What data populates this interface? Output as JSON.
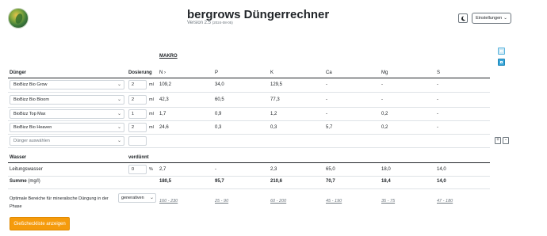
{
  "header": {
    "title": "bergrows Düngerrechner",
    "version": "Version 2.5",
    "version_date": "(2024-08-05)",
    "settings_label": "Einstellungen"
  },
  "section_title": "MAKRO",
  "table": {
    "headers": [
      "Dünger",
      "Dosierung",
      "N",
      "P",
      "K",
      "Ca",
      "Mg",
      "S"
    ],
    "rows": [
      {
        "name": "BioBizz Bio Grow",
        "qty": "2",
        "unit": "ml",
        "N": "109,2",
        "P": "34,0",
        "K": "129,5",
        "Ca": "-",
        "Mg": "-",
        "S": "-"
      },
      {
        "name": "BioBizz Bio Bloom",
        "qty": "2",
        "unit": "ml",
        "N": "42,3",
        "P": "60,5",
        "K": "77,3",
        "Ca": "-",
        "Mg": "-",
        "S": "-"
      },
      {
        "name": "BioBizz Top Max",
        "qty": "1",
        "unit": "ml",
        "N": "1,7",
        "P": "0,9",
        "K": "1,2",
        "Ca": "-",
        "Mg": "0,2",
        "S": "-"
      },
      {
        "name": "BioBizz Bio Heaven",
        "qty": "2",
        "unit": "ml",
        "N": "24,6",
        "P": "0,3",
        "K": "0,3",
        "Ca": "5,7",
        "Mg": "0,2",
        "S": "-"
      }
    ],
    "add_placeholder": "Dünger auswählen"
  },
  "water": {
    "header_wasser": "Wasser",
    "header_verduennt": "verdünnt",
    "label": "Leitungswasser",
    "qty": "0",
    "unit": "%",
    "N": "2,7",
    "P": "-",
    "K": "2,3",
    "Ca": "65,0",
    "Mg": "18,0",
    "S": "14,0"
  },
  "summe": {
    "label": "Summe",
    "unit": "(mg/l)",
    "N": "180,5",
    "P": "95,7",
    "K": "210,6",
    "Ca": "70,7",
    "Mg": "18,4",
    "S": "14,0"
  },
  "optimal": {
    "text_before": "Optimale Bereiche für mineralische Düngung in der",
    "phase_select": "generativen",
    "text_after": "Phase",
    "N": "160 - 230",
    "P": "25 - 90",
    "K": "60 - 200",
    "Ca": "45 - 190",
    "Mg": "35 - 75",
    "S": "47 - 180"
  },
  "buttons": {
    "checklist": "Gießcheckliste anzeigen",
    "plus": "+",
    "minus": "-"
  },
  "colors": {
    "accent": "#f59b0c",
    "info": "#3aa7d9"
  }
}
